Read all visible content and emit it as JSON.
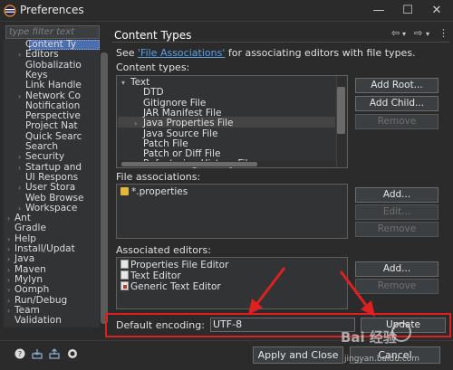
{
  "window": {
    "title": "Preferences",
    "minimize": "—",
    "maximize": "☐",
    "close": "✕"
  },
  "sidebar": {
    "filter_placeholder": "type filter text",
    "items": [
      {
        "label": "Content Ty",
        "indent": 2,
        "arrow": ""
      },
      {
        "label": "Editors",
        "indent": 2,
        "arrow": "›"
      },
      {
        "label": "Globalizatio",
        "indent": 2,
        "arrow": ""
      },
      {
        "label": "Keys",
        "indent": 2,
        "arrow": ""
      },
      {
        "label": "Link Handle",
        "indent": 2,
        "arrow": ""
      },
      {
        "label": "Network Co",
        "indent": 2,
        "arrow": "›"
      },
      {
        "label": "Notification",
        "indent": 2,
        "arrow": ""
      },
      {
        "label": "Perspective",
        "indent": 2,
        "arrow": ""
      },
      {
        "label": "Project Nat",
        "indent": 2,
        "arrow": ""
      },
      {
        "label": "Quick Searc",
        "indent": 2,
        "arrow": ""
      },
      {
        "label": "Search",
        "indent": 2,
        "arrow": ""
      },
      {
        "label": "Security",
        "indent": 2,
        "arrow": "›"
      },
      {
        "label": "Startup and",
        "indent": 2,
        "arrow": "›"
      },
      {
        "label": "UI Respons",
        "indent": 2,
        "arrow": ""
      },
      {
        "label": "User Stora",
        "indent": 2,
        "arrow": "›"
      },
      {
        "label": "Web Browse",
        "indent": 2,
        "arrow": ""
      },
      {
        "label": "Workspace",
        "indent": 2,
        "arrow": "›"
      },
      {
        "label": "Ant",
        "indent": 1,
        "arrow": "›"
      },
      {
        "label": "Gradle",
        "indent": 1,
        "arrow": ""
      },
      {
        "label": "Help",
        "indent": 1,
        "arrow": "›"
      },
      {
        "label": "Install/Updat",
        "indent": 1,
        "arrow": "›"
      },
      {
        "label": "Java",
        "indent": 1,
        "arrow": "›"
      },
      {
        "label": "Maven",
        "indent": 1,
        "arrow": "›"
      },
      {
        "label": "Mylyn",
        "indent": 1,
        "arrow": "›"
      },
      {
        "label": "Oomph",
        "indent": 1,
        "arrow": "›"
      },
      {
        "label": "Run/Debug",
        "indent": 1,
        "arrow": "›"
      },
      {
        "label": "Team",
        "indent": 1,
        "arrow": "›"
      },
      {
        "label": "Validation",
        "indent": 1,
        "arrow": ""
      }
    ]
  },
  "page": {
    "title": "Content Types",
    "nav": {
      "back": "⇦",
      "back_menu": "▾",
      "forward": "⇨",
      "forward_menu": "▾",
      "menu": "⋮"
    },
    "intro_prefix": "See ",
    "intro_link": "'File Associations'",
    "intro_suffix": " for associating editors with file types.",
    "content_types_label": "Content types:",
    "content_types": [
      {
        "label": "Text",
        "arrow": "▾",
        "level": 0
      },
      {
        "label": "DTD",
        "arrow": "",
        "level": 1
      },
      {
        "label": "Gitignore File",
        "arrow": "",
        "level": 1
      },
      {
        "label": "JAR Manifest File",
        "arrow": "",
        "level": 1
      },
      {
        "label": "Java Properties File",
        "arrow": "›",
        "level": 1
      },
      {
        "label": "Java Source File",
        "arrow": "",
        "level": 1
      },
      {
        "label": "Patch File",
        "arrow": "",
        "level": 1
      },
      {
        "label": "Patch or Diff File",
        "arrow": "",
        "level": 1
      },
      {
        "label": "Refactoring History File",
        "arrow": "",
        "level": 1
      }
    ],
    "ct_buttons": {
      "add_root": "Add Root...",
      "add_child": "Add Child...",
      "remove": "Remove"
    },
    "file_assoc_label": "File associations:",
    "file_associations": [
      "*.properties"
    ],
    "fa_buttons": {
      "add": "Add...",
      "edit": "Edit...",
      "remove": "Remove"
    },
    "assoc_editors_label": "Associated editors:",
    "associated_editors": [
      "Properties File Editor",
      "Text Editor",
      "Generic Text Editor"
    ],
    "ae_buttons": {
      "add": "Add...",
      "remove": "Remove"
    },
    "encoding_label": "Default encoding:",
    "encoding_value": "UTF-8",
    "update_button": "Update"
  },
  "footer": {
    "apply_close": "Apply and Close",
    "cancel": "Cancel"
  },
  "watermark": {
    "text": "Bai 经验",
    "sub": "jingyan.baidu.com"
  },
  "colors": {
    "accent": "#4b6eaf",
    "link": "#5aa0e6",
    "highlight": "#e02020"
  }
}
